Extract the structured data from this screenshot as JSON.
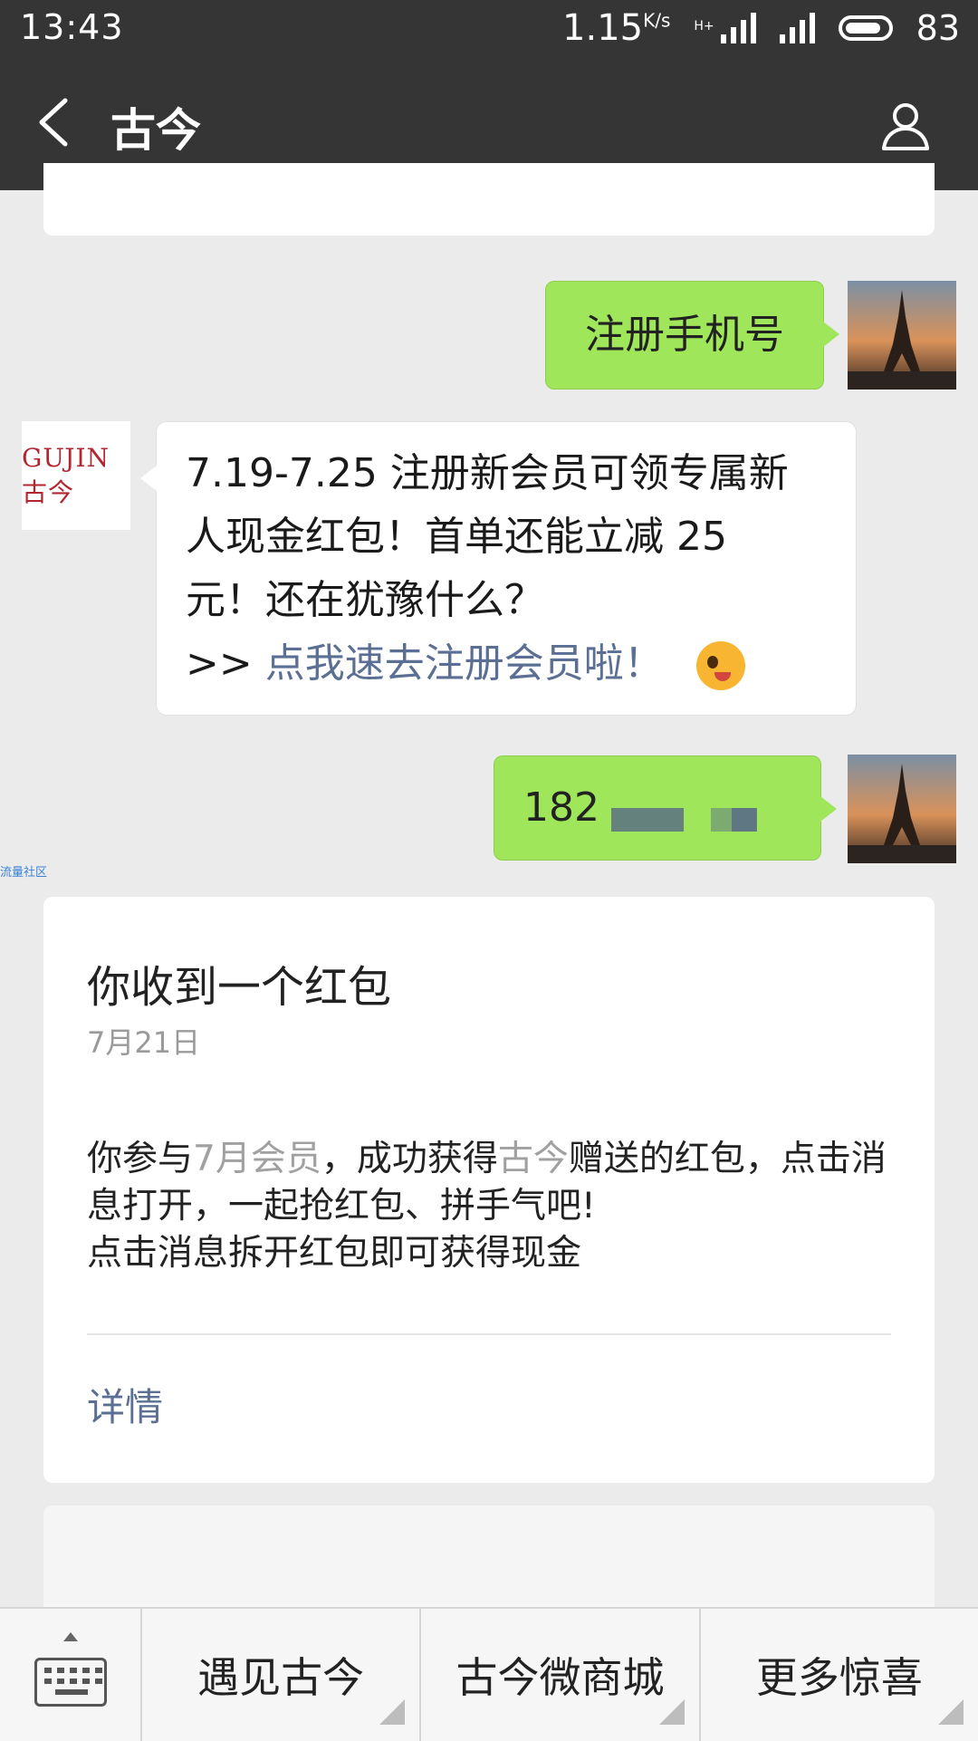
{
  "status_bar": {
    "time": "13:43",
    "speed": "1.15",
    "speed_unit": "K/s",
    "network": "H+",
    "battery": "83"
  },
  "header": {
    "title": "古今"
  },
  "messages": {
    "m1": "注册手机号",
    "m2_lines": [
      "7.19-7.25 注册新会员可领专属新",
      "人现金红包！首单还能立减 25",
      "元！还在犹豫什么？"
    ],
    "m2_prefix": ">> ",
    "m2_link": "点我速去注册会员啦！",
    "brand_logo": "GUJIN古今",
    "m3": "182"
  },
  "watermark": "流量社区",
  "card": {
    "title": "你收到一个红包",
    "date": "7月21日",
    "body_1": "你参与",
    "body_hl1": "7月会员",
    "body_2": "，成功获得",
    "body_hl2": "古今",
    "body_3": "赠送的红包，点击消息打开，一起抢红包、拼手气吧!",
    "body_4": "点击消息拆开红包即可获得现金",
    "detail": "详情"
  },
  "menu": {
    "items": [
      "遇见古今",
      "古今微商城",
      "更多惊喜"
    ]
  },
  "icons": [
    "back-arrow-icon",
    "profile-icon",
    "keyboard-icon",
    "wink-emoji-icon"
  ]
}
